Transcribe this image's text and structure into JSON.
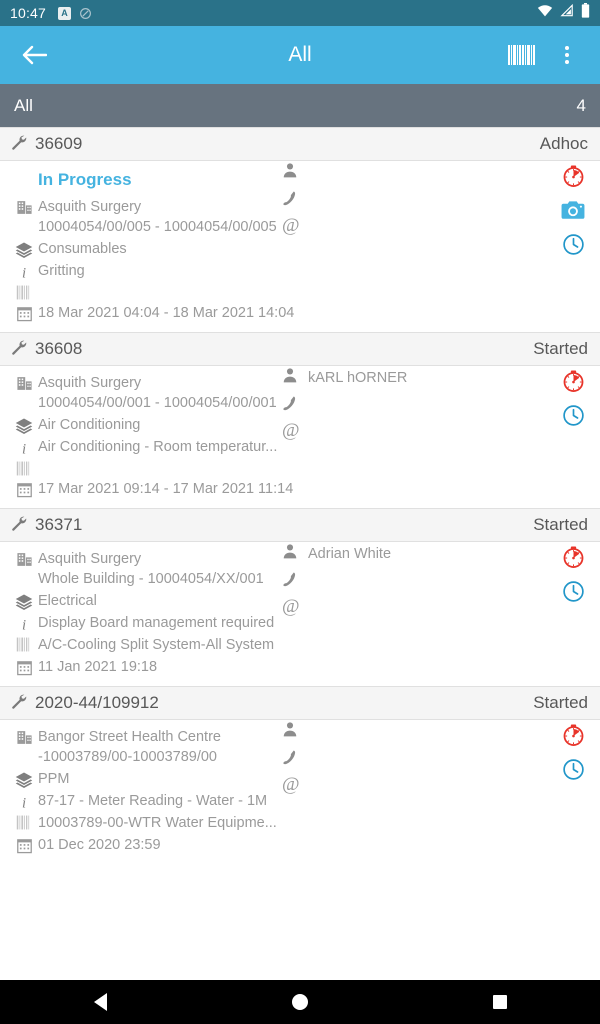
{
  "status_bar": {
    "time": "10:47",
    "left_icons": [
      "app-badge-icon",
      "do-not-disturb-icon"
    ],
    "right_icons": [
      "wifi-icon",
      "cellular-signal-icon",
      "battery-icon"
    ]
  },
  "toolbar": {
    "back_label": "back-arrow",
    "title": "All",
    "barcode_label": "barcode-scan",
    "overflow_label": "more-options"
  },
  "filter_bar": {
    "label": "All",
    "count": "4"
  },
  "colors": {
    "status_bar": "#2a7289",
    "toolbar": "#45b3e0",
    "filter_bar": "#67737f",
    "accent": "#45b3e0",
    "timer_red": "#e8342a",
    "card_header": "#f5f5f5",
    "body_text": "#9a9a9a",
    "header_text": "#585858"
  },
  "cards": [
    {
      "work_order": "36609",
      "status": "Adhoc",
      "progress_label": "In Progress",
      "site": "Asquith Surgery\n10004054/00/005 - 10004054/00/005",
      "category": "Consumables",
      "description": "Gritting",
      "asset": "",
      "schedule": "18 Mar 2021 04:04 - 18 Mar 2021 14:04",
      "contact_name": "",
      "actions": [
        "stopwatch-icon",
        "camera-icon",
        "clock-icon"
      ]
    },
    {
      "work_order": "36608",
      "status": "Started",
      "progress_label": "",
      "site": "Asquith Surgery\n10004054/00/001 - 10004054/00/001",
      "category": "Air Conditioning",
      "description": "Air Conditioning - Room temperatur...",
      "asset": "",
      "schedule": "17 Mar 2021 09:14 - 17 Mar 2021 11:14",
      "contact_name": "kARL hORNER",
      "actions": [
        "stopwatch-icon",
        "clock-icon"
      ]
    },
    {
      "work_order": "36371",
      "status": "Started",
      "progress_label": "",
      "site": "Asquith Surgery\nWhole Building - 10004054/XX/001",
      "category": "Electrical",
      "description": "Display Board management required",
      "asset": "A/C-Cooling Split System-All System",
      "schedule": "11 Jan 2021 19:18",
      "contact_name": "Adrian White",
      "actions": [
        "stopwatch-icon",
        "clock-icon"
      ]
    },
    {
      "work_order": "2020-44/109912",
      "status": "Started",
      "progress_label": "",
      "site": "Bangor Street Health Centre\n-10003789/00-10003789/00",
      "category": "PPM",
      "description": "87-17 - Meter Reading - Water - 1M",
      "asset": "10003789-00-WTR   Water Equipme...",
      "schedule": "01 Dec 2020 23:59",
      "contact_name": "",
      "actions": [
        "stopwatch-icon",
        "clock-icon"
      ]
    }
  ],
  "row_icons": {
    "work_order": "wrench-icon",
    "site": "building-icon",
    "category": "layers-icon",
    "description": "info-icon",
    "asset": "barcode-icon",
    "schedule": "calendar-icon",
    "contact_person": "person-icon",
    "contact_phone": "phone-icon",
    "contact_email": "at-sign-icon"
  },
  "nav_bar": {
    "back": "nav-back-icon",
    "home": "nav-home-icon",
    "recents": "nav-recents-icon"
  }
}
